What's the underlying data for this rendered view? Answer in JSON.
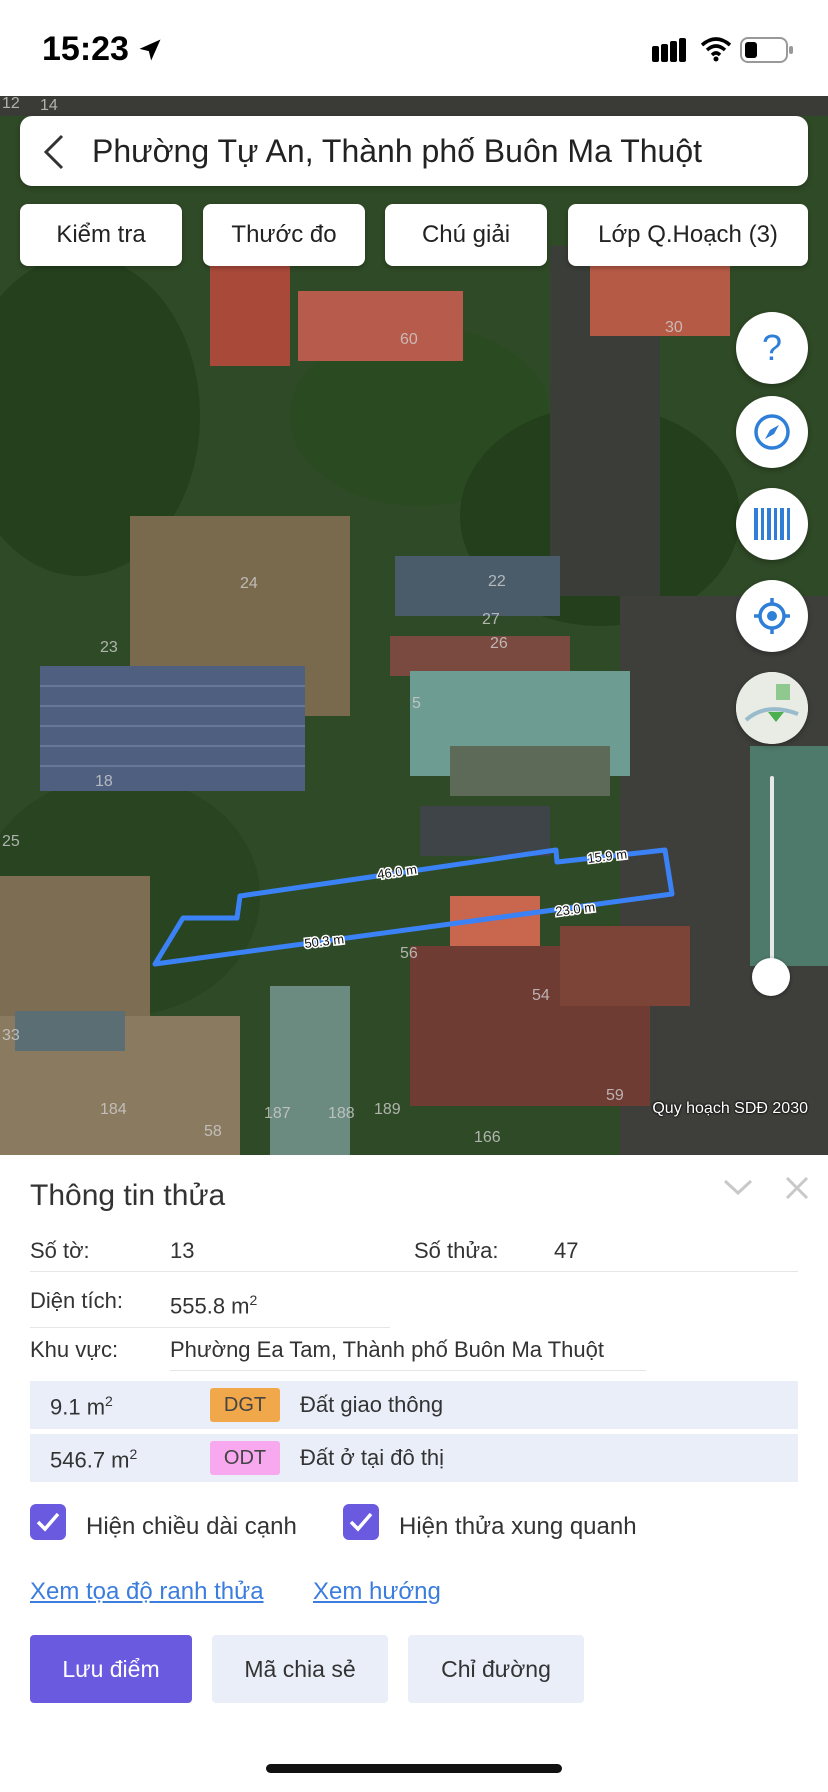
{
  "status_bar": {
    "time": "15:23"
  },
  "search": {
    "title": "Phường Tự An, Thành phố Buôn Ma Thuột"
  },
  "toolbar": {
    "check_label": "Kiểm tra",
    "ruler_label": "Thước đo",
    "legend_label": "Chú giải",
    "layers_label": "Lớp Q.Hoạch (3)"
  },
  "map": {
    "caption": "Quy hoạch SDĐ 2030",
    "edge_labels": [
      "46.0 m",
      "15.9 m",
      "23.0 m",
      "50.3 m"
    ],
    "parcel_numbers": [
      "12",
      "14",
      "60",
      "30",
      "24",
      "22",
      "27",
      "26",
      "23",
      "18",
      "5",
      "56",
      "54",
      "25",
      "33",
      "184",
      "58",
      "187",
      "188",
      "189",
      "166",
      "59"
    ],
    "parcel_outline_color": "#3b82f6"
  },
  "panel": {
    "title": "Thông tin thửa",
    "sheet_label": "Số tờ:",
    "sheet_value": "13",
    "parcel_label": "Số thửa:",
    "parcel_value": "47",
    "area_label": "Diện tích:",
    "area_value": "555.8 m",
    "area_unit_sup": "2",
    "region_label": "Khu vực:",
    "region_value": "Phường Ea Tam, Thành phố Buôn Ma Thuột",
    "land_uses": [
      {
        "area": "9.1 m",
        "sup": "2",
        "code": "DGT",
        "name": "Đất giao thông",
        "color": "#f0a84a"
      },
      {
        "area": "546.7 m",
        "sup": "2",
        "code": "ODT",
        "name": "Đất ở tại đô thị",
        "color": "#f7a8ee"
      }
    ],
    "show_edge_lengths": {
      "label": "Hiện chiều dài cạnh",
      "checked": true
    },
    "show_neighbors": {
      "label": "Hiện thửa xung quanh",
      "checked": true
    },
    "link_coordinates": "Xem tọa độ ranh thửa",
    "link_direction": "Xem hướng",
    "save_label": "Lưu điểm",
    "share_label": "Mã chia sẻ",
    "directions_label": "Chỉ đường"
  },
  "colors": {
    "accent": "#6a5ae0",
    "link": "#3b7ddd",
    "secondary_button": "#e9eef9"
  }
}
